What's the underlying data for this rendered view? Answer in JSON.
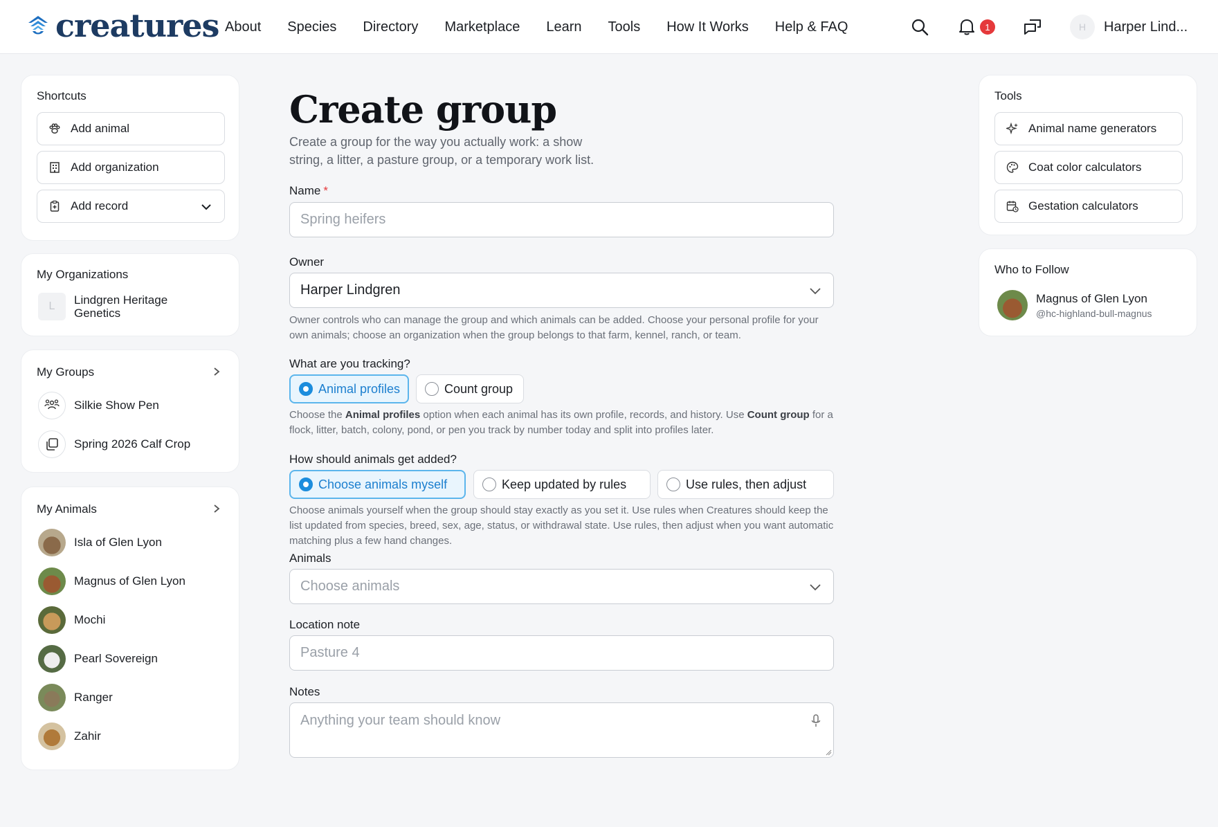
{
  "brand": {
    "name": "creatures"
  },
  "nav": {
    "items": [
      "About",
      "Species",
      "Directory",
      "Marketplace",
      "Learn",
      "Tools",
      "How It Works",
      "Help & FAQ"
    ]
  },
  "header": {
    "notification_count": "1",
    "user_initial": "H",
    "user_name": "Harper Lind..."
  },
  "shortcuts": {
    "title": "Shortcuts",
    "add_animal": "Add animal",
    "add_organization": "Add organization",
    "add_record": "Add record"
  },
  "organizations": {
    "title": "My Organizations",
    "items": [
      {
        "initial": "L",
        "name": "Lindgren Heritage Genetics"
      }
    ]
  },
  "groups": {
    "title": "My Groups",
    "items": [
      "Silkie Show Pen",
      "Spring 2026 Calf Crop"
    ]
  },
  "animals": {
    "title": "My Animals",
    "items": [
      "Isla of Glen Lyon",
      "Magnus of Glen Lyon",
      "Mochi",
      "Pearl Sovereign",
      "Ranger",
      "Zahir"
    ]
  },
  "form": {
    "title": "Create group",
    "subtitle": "Create a group for the way you actually work: a show string, a litter, a pasture group, or a temporary work list.",
    "name": {
      "label": "Name",
      "required": "*",
      "placeholder": "Spring heifers"
    },
    "owner": {
      "label": "Owner",
      "value": "Harper Lindgren",
      "help": "Owner controls who can manage the group and which animals can be added. Choose your personal profile for your own animals; choose an organization when the group belongs to that farm, kennel, ranch, or team."
    },
    "tracking": {
      "label": "What are you tracking?",
      "options": [
        "Animal profiles",
        "Count group"
      ],
      "selected": "Animal profiles",
      "help_1": "Choose the ",
      "help_b1": "Animal profiles",
      "help_2": " option when each animal has its own profile, records, and history. Use ",
      "help_b2": "Count group",
      "help_3": " for a flock, litter, batch, colony, pond, or pen you track by number today and split into profiles later."
    },
    "adding": {
      "label": "How should animals get added?",
      "options": [
        "Choose animals myself",
        "Keep updated by rules",
        "Use rules, then adjust"
      ],
      "selected": "Choose animals myself",
      "help": "Choose animals yourself when the group should stay exactly as you set it. Use rules when Creatures should keep the list updated from species, breed, sex, age, status, or withdrawal state. Use rules, then adjust when you want automatic matching plus a few hand changes."
    },
    "animals": {
      "label": "Animals",
      "placeholder": "Choose animals"
    },
    "location": {
      "label": "Location note",
      "placeholder": "Pasture 4"
    },
    "notes": {
      "label": "Notes",
      "placeholder": "Anything your team should know"
    }
  },
  "tools": {
    "title": "Tools",
    "items": [
      "Animal name generators",
      "Coat color calculators",
      "Gestation calculators"
    ]
  },
  "follow": {
    "title": "Who to Follow",
    "name": "Magnus of Glen Lyon",
    "handle": "@hc-highland-bull-magnus"
  },
  "colors": {
    "brand": "#1d3b62",
    "accent": "#1c8ddd",
    "badge": "#e5393b"
  }
}
